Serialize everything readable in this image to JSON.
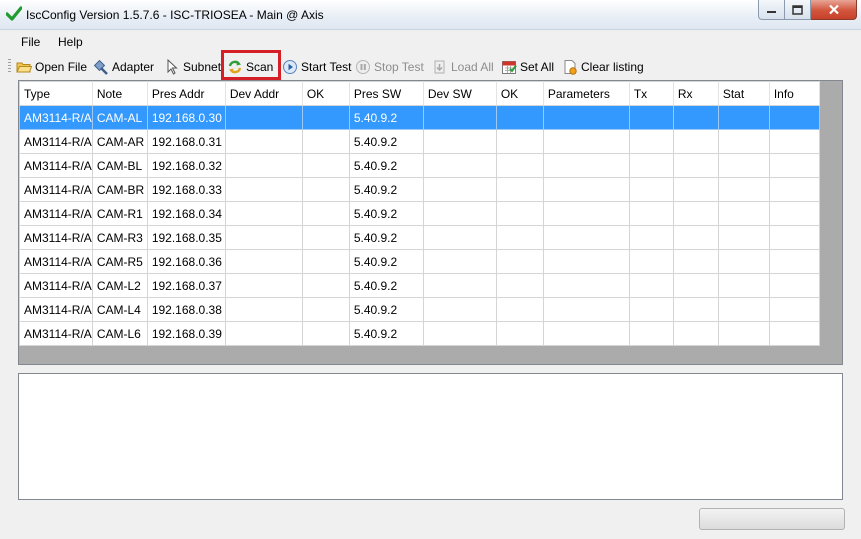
{
  "window": {
    "title": "IscConfig Version 1.5.7.6 - ISC-TRIOSEA - Main @ Axis"
  },
  "menu": {
    "items": [
      "File",
      "Help"
    ]
  },
  "toolbar": {
    "open_file": "Open File",
    "adapter": "Adapter",
    "subnet": "Subnet",
    "scan": "Scan",
    "start_test": "Start Test",
    "stop_test": "Stop Test",
    "load_all": "Load All",
    "set_all": "Set All",
    "clear_listing": "Clear listing"
  },
  "grid": {
    "columns": [
      "Type",
      "Note",
      "Pres Addr",
      "Dev Addr",
      "OK",
      "Pres SW",
      "Dev SW",
      "OK",
      "Parameters",
      "Tx",
      "Rx",
      "Stat",
      "Info"
    ],
    "rows": [
      [
        "AM3114-R/A",
        "CAM-AL",
        "192.168.0.30",
        "",
        "",
        "5.40.9.2",
        "",
        "",
        "",
        "",
        "",
        "",
        ""
      ],
      [
        "AM3114-R/A",
        "CAM-AR",
        "192.168.0.31",
        "",
        "",
        "5.40.9.2",
        "",
        "",
        "",
        "",
        "",
        "",
        ""
      ],
      [
        "AM3114-R/A",
        "CAM-BL",
        "192.168.0.32",
        "",
        "",
        "5.40.9.2",
        "",
        "",
        "",
        "",
        "",
        "",
        ""
      ],
      [
        "AM3114-R/A",
        "CAM-BR",
        "192.168.0.33",
        "",
        "",
        "5.40.9.2",
        "",
        "",
        "",
        "",
        "",
        "",
        ""
      ],
      [
        "AM3114-R/A",
        "CAM-R1",
        "192.168.0.34",
        "",
        "",
        "5.40.9.2",
        "",
        "",
        "",
        "",
        "",
        "",
        ""
      ],
      [
        "AM3114-R/A",
        "CAM-R3",
        "192.168.0.35",
        "",
        "",
        "5.40.9.2",
        "",
        "",
        "",
        "",
        "",
        "",
        ""
      ],
      [
        "AM3114-R/A",
        "CAM-R5",
        "192.168.0.36",
        "",
        "",
        "5.40.9.2",
        "",
        "",
        "",
        "",
        "",
        "",
        ""
      ],
      [
        "AM3114-R/A",
        "CAM-L2",
        "192.168.0.37",
        "",
        "",
        "5.40.9.2",
        "",
        "",
        "",
        "",
        "",
        "",
        ""
      ],
      [
        "AM3114-R/A",
        "CAM-L4",
        "192.168.0.38",
        "",
        "",
        "5.40.9.2",
        "",
        "",
        "",
        "",
        "",
        "",
        ""
      ],
      [
        "AM3114-R/A",
        "CAM-L6",
        "192.168.0.39",
        "",
        "",
        "5.40.9.2",
        "",
        "",
        "",
        "",
        "",
        "",
        ""
      ]
    ],
    "selected_row": 0
  },
  "colors": {
    "selection": "#3399ff",
    "highlight": "#d41f26"
  }
}
